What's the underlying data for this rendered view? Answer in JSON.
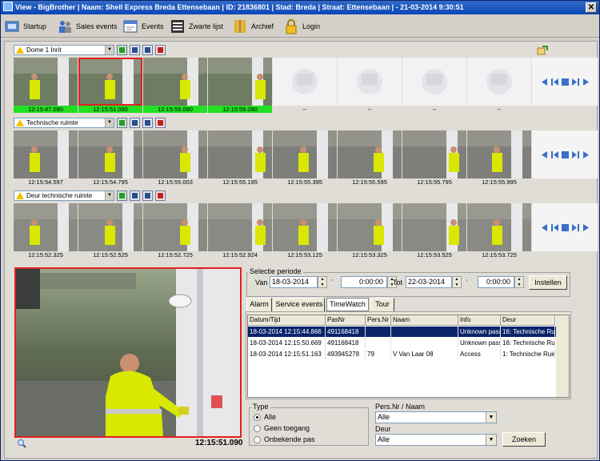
{
  "window": {
    "title": "View - BigBrother | Naam: Shell Express Breda Ettensebaan | ID: 21836801 | Stad: Breda | Straat: Ettensebaan  | - 21-03-2014 9:30:51",
    "close_label": "✕"
  },
  "toolbar": {
    "startup": "Startup",
    "sales_events": "Sales events",
    "events": "Events",
    "zwarte_lijst": "Zwarte lijst",
    "archief": "Archief",
    "login": "Login"
  },
  "cameras": [
    {
      "name": "Dome 1 Inrit",
      "timestamps": [
        "12:15:47.090",
        "12:15:51.090",
        "12:15:55.090",
        "12:15:59.090",
        "--",
        "--",
        "--",
        "--"
      ]
    },
    {
      "name": "Technische ruimte",
      "timestamps": [
        "12:15:54.597",
        "12:15:54.795",
        "12:15:55.003",
        "12:15:55.195",
        "12:15:55.395",
        "12:15:55.595",
        "12:15:55.795",
        "12:15:55.995"
      ]
    },
    {
      "name": "Deur technische ruimte",
      "timestamps": [
        "12:15:52.325",
        "12:15:52.525",
        "12:15:52.725",
        "12:15:52.924",
        "12:15:53.125",
        "12:15:53.325",
        "12:15:53.525",
        "12:15:53.725"
      ]
    }
  ],
  "bigview": {
    "timestamp": "12:15:51.090"
  },
  "periode": {
    "title": "Selectie periode",
    "van_label": "Van",
    "van_date": "18-03-2014",
    "van_time": "0:00:00",
    "tot_label": "Tot",
    "tot_date": "22-03-2014",
    "tot_time": "0:00:00",
    "instellen": "Instellen"
  },
  "tabs": [
    "Alarm",
    "Service events",
    "TimeWatch",
    "Tour"
  ],
  "active_tab": "TimeWatch",
  "table": {
    "columns": [
      "Datum/Tijd",
      "PasNr",
      "Pers.Nr",
      "Naam",
      "Info",
      "Deur"
    ],
    "rows": [
      [
        "18-03-2014 12:15:44.866",
        "491168418",
        "",
        "",
        "Unknown pass",
        "16: Technische Rui"
      ],
      [
        "18-03-2014 12:15:50.669",
        "491168418",
        "",
        "",
        "Unknown pass",
        "16: Technische Rui"
      ],
      [
        "18-03-2014 12:15:51.163",
        "493945278",
        "79",
        "V  Van Laar 08",
        "Access",
        "1: Technische Ruim"
      ]
    ],
    "selected_row": 0
  },
  "filter": {
    "type_label": "Type",
    "options": [
      "Alle",
      "Geen toegang",
      "Onbekende pas"
    ],
    "selected": "Alle",
    "pers_label": "Pers.Nr / Naam",
    "pers_value": "Alle",
    "deur_label": "Deur",
    "deur_value": "Alle",
    "zoeken": "Zoeken"
  },
  "colors": {
    "titlebar": "#0a47b8",
    "highlight_red": "#e02020",
    "timestamp_green": "#22e022",
    "selection": "#0a246a"
  }
}
